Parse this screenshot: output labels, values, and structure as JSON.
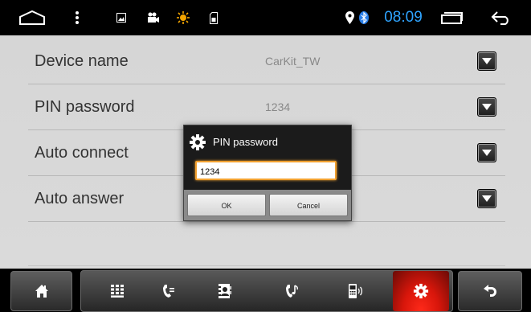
{
  "status_bar": {
    "time": "08:09",
    "icons": [
      "home-outline-icon",
      "menu-dots-icon",
      "image-icon",
      "video-camera-icon",
      "brightness-icon",
      "sd-card-icon",
      "location-pin-icon",
      "bluetooth-icon",
      "recent-apps-icon",
      "back-arrow-icon"
    ],
    "time_color": "#2fa4ff"
  },
  "settings": {
    "rows": [
      {
        "label": "Device name",
        "value": "CarKit_TW"
      },
      {
        "label": "PIN password",
        "value": "1234"
      },
      {
        "label": "Auto connect",
        "value": ""
      },
      {
        "label": "Auto answer",
        "value": ""
      }
    ]
  },
  "dialog": {
    "title": "PIN password",
    "input_value": "1234",
    "ok_label": "OK",
    "cancel_label": "Cancel",
    "focus_color": "#f0a030"
  },
  "bottom_bar": {
    "tabs": [
      "keypad-icon",
      "call-log-icon",
      "contacts-icon",
      "music-icon",
      "phone-audio-icon",
      "settings-icon"
    ],
    "active_tab": "settings-icon",
    "active_color": "#d8160b"
  }
}
